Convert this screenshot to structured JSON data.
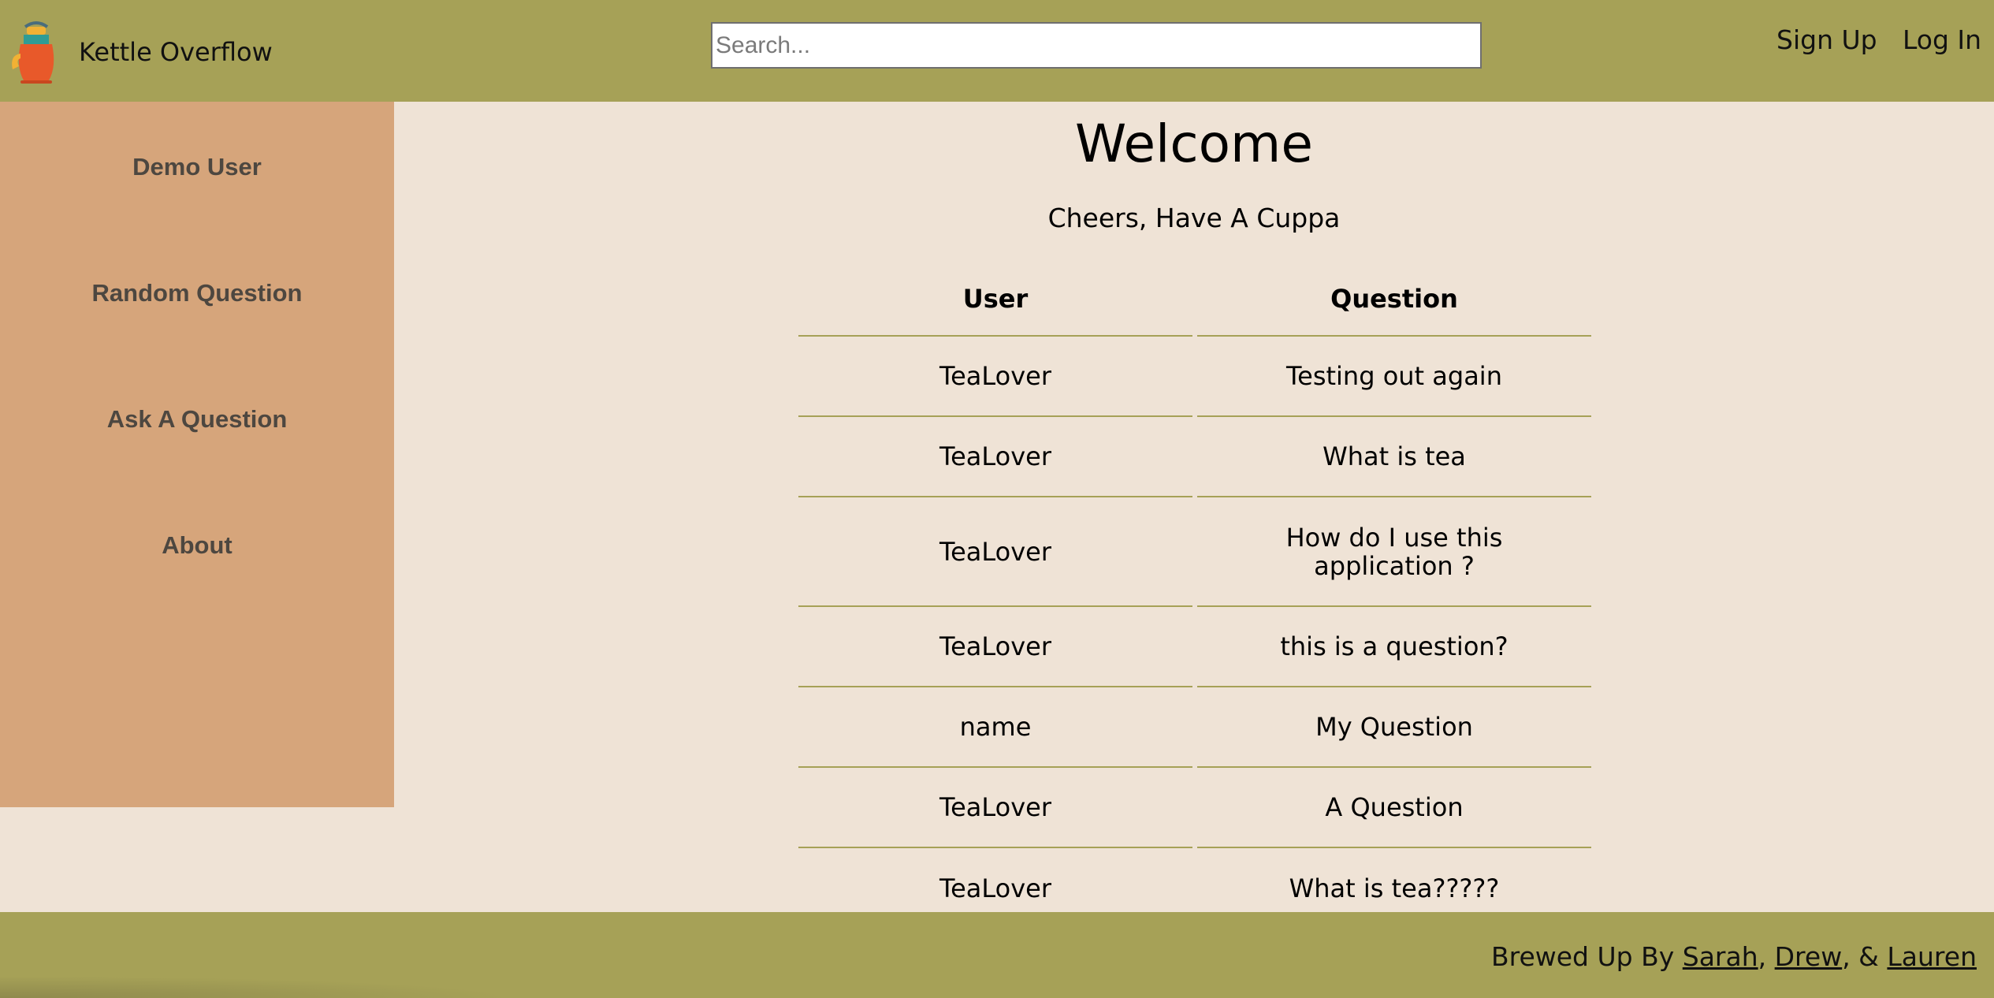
{
  "header": {
    "brand": "Kettle Overflow",
    "search_placeholder": "Search...",
    "signup_label": "Sign Up",
    "login_label": "Log In"
  },
  "sidebar": {
    "items": [
      {
        "label": "Demo User"
      },
      {
        "label": "Random Question"
      },
      {
        "label": "Ask A Question"
      },
      {
        "label": "About"
      }
    ]
  },
  "main": {
    "title": "Welcome",
    "subtitle": "Cheers, Have A Cuppa",
    "table": {
      "headers": [
        "User",
        "Question"
      ],
      "rows": [
        {
          "user": "TeaLover",
          "question": "Testing out again"
        },
        {
          "user": "TeaLover",
          "question": "What is tea"
        },
        {
          "user": "TeaLover",
          "question": "How do I use this application ?"
        },
        {
          "user": "TeaLover",
          "question": "this is a question?"
        },
        {
          "user": "name",
          "question": "My Question"
        },
        {
          "user": "TeaLover",
          "question": "A Question"
        },
        {
          "user": "TeaLover",
          "question": "What is tea?????"
        }
      ]
    }
  },
  "footer": {
    "prefix": "Brewed Up By",
    "author1": "Sarah",
    "sep1": ",",
    "author2": "Drew",
    "sep2": ", &",
    "author3": "Lauren"
  },
  "colors": {
    "header_bg": "#a6a157",
    "sidebar_bg": "#d6a57b",
    "page_bg": "#efe3d6",
    "divider": "#a6a157"
  },
  "icons": {
    "logo": "teapot-icon"
  }
}
